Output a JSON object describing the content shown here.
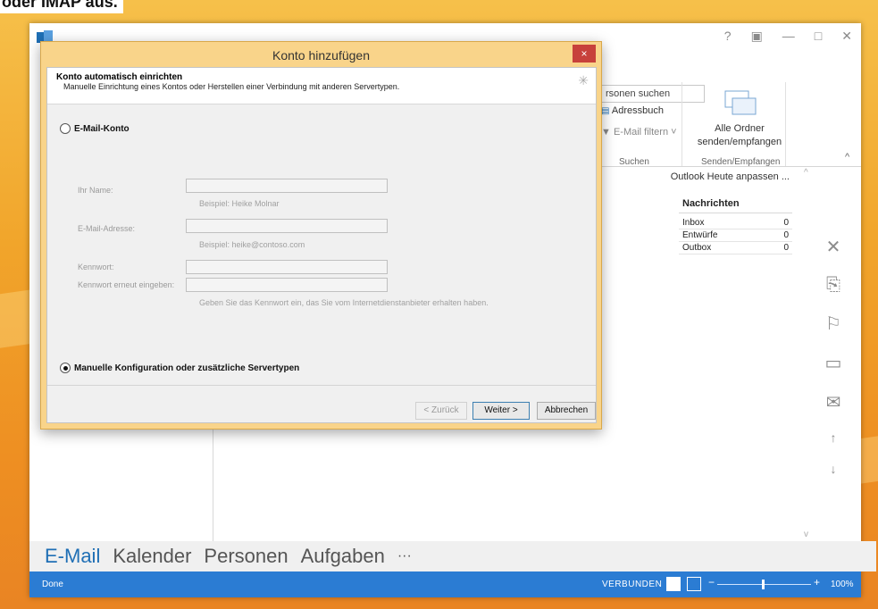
{
  "caption": {
    "text": "oder IMAP aus."
  },
  "ribbon": {
    "search_people": "rsonen suchen",
    "address_book": "Adressbuch",
    "filter_mail": "E-Mail filtern",
    "group_search": "Suchen",
    "send_receive_all": "Alle Ordner senden/empfangen",
    "group_send_receive": "Senden/Empfangen"
  },
  "today": {
    "customize": "Outlook Heute anpassen ...",
    "messages_title": "Nachrichten",
    "rows": [
      {
        "label": "Inbox",
        "count": "0"
      },
      {
        "label": "Entwürfe",
        "count": "0"
      },
      {
        "label": "Outbox",
        "count": "0"
      }
    ]
  },
  "bottom_nav": {
    "mail": "E-Mail",
    "calendar": "Kalender",
    "people": "Personen",
    "tasks": "Aufgaben",
    "more": "···"
  },
  "status": {
    "left": "Done",
    "connection": "VERBUNDEN",
    "zoom": "100%"
  },
  "dialog": {
    "title": "Konto hinzufügen",
    "close": "×",
    "head_title": "Konto automatisch einrichten",
    "head_sub": "Manuelle Einrichtung eines Kontos oder Herstellen einer Verbindung mit anderen Servertypen.",
    "option_email": "E-Mail-Konto",
    "label_name": "Ihr Name:",
    "hint_name": "Beispiel: Heike Molnar",
    "label_email": "E-Mail-Adresse:",
    "hint_email": "Beispiel: heike@contoso.com",
    "label_password": "Kennwort:",
    "label_password_repeat": "Kennwort erneut eingeben:",
    "hint_password": "Geben Sie das Kennwort ein, das Sie vom Internetdienstanbieter erhalten haben.",
    "option_manual": "Manuelle Konfiguration oder zusätzliche Servertypen",
    "btn_back": "< Zurück",
    "btn_next": "Weiter >",
    "btn_cancel": "Abbrechen"
  },
  "colors": {
    "accent": "#2b7cd3",
    "dialog_frame": "#f9d48a",
    "close": "#c7413b"
  }
}
